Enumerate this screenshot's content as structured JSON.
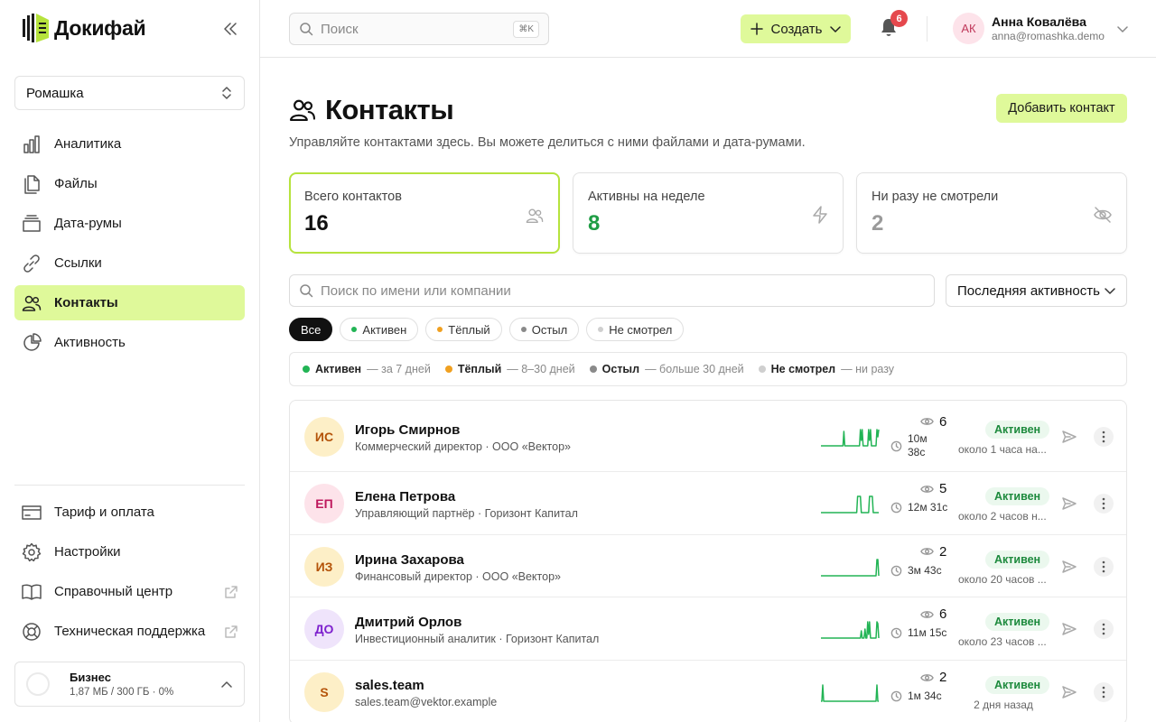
{
  "brand": {
    "name": "Докифай"
  },
  "workspace": {
    "name": "Ромашка"
  },
  "nav": {
    "items": [
      {
        "label": "Аналитика",
        "icon": "bar-chart-icon"
      },
      {
        "label": "Файлы",
        "icon": "files-icon"
      },
      {
        "label": "Дата-румы",
        "icon": "dataroom-icon"
      },
      {
        "label": "Ссылки",
        "icon": "link-icon"
      },
      {
        "label": "Контакты",
        "icon": "contacts-icon",
        "active": true
      },
      {
        "label": "Активность",
        "icon": "pie-chart-icon"
      }
    ],
    "bottom": [
      {
        "label": "Тариф и оплата",
        "icon": "credit-card-icon"
      },
      {
        "label": "Настройки",
        "icon": "gear-icon"
      },
      {
        "label": "Справочный центр",
        "icon": "book-icon",
        "external": true
      },
      {
        "label": "Техническая поддержка",
        "icon": "lifebuoy-icon",
        "external": true
      }
    ]
  },
  "plan": {
    "name": "Бизнес",
    "usage": "1,87 МБ / 300 ГБ · 0%"
  },
  "topbar": {
    "search_placeholder": "Поиск",
    "shortcut": "⌘K",
    "create_label": "Создать",
    "notifications_count": "6",
    "user": {
      "initials": "АК",
      "name": "Анна Ковалёва",
      "email": "anna@romashka.demo"
    }
  },
  "page": {
    "title": "Контакты",
    "subtitle": "Управляйте контактами здесь. Вы можете делиться с ними файлами и дата-румами.",
    "add_label": "Добавить контакт"
  },
  "stats": [
    {
      "label": "Всего контактов",
      "value": "16",
      "color": "#111111",
      "icon": "users-icon"
    },
    {
      "label": "Активны на неделе",
      "value": "8",
      "color": "#1f9d45",
      "icon": "zap-icon"
    },
    {
      "label": "Ни разу не смотрели",
      "value": "2",
      "color": "#9a9a9a",
      "icon": "eye-off-icon"
    }
  ],
  "filters": {
    "search_placeholder": "Поиск по имени или компании",
    "sort_label": "Последняя активность",
    "pills": [
      {
        "label": "Все",
        "active": true
      },
      {
        "label": "Активен",
        "dot": "#22b455"
      },
      {
        "label": "Тёплый",
        "dot": "#f0a020"
      },
      {
        "label": "Остыл",
        "dot": "#8a8a8a"
      },
      {
        "label": "Не смотрел",
        "dot": "#cfcfcf"
      }
    ]
  },
  "legend": [
    {
      "label": "Активен",
      "desc": "— за 7 дней",
      "color": "#22b455"
    },
    {
      "label": "Тёплый",
      "desc": "— 8–30 дней",
      "color": "#f0a020"
    },
    {
      "label": "Остыл",
      "desc": "— больше 30 дней",
      "color": "#8a8a8a"
    },
    {
      "label": "Не смотрел",
      "desc": "— ни разу",
      "color": "#cfcfcf"
    }
  ],
  "contacts": [
    {
      "initials": "ИС",
      "name": "Игорь Смирнов",
      "subtitle": "Коммерческий директор · ООО «Вектор»",
      "views": "6",
      "duration": [
        "10м",
        "38с"
      ],
      "status": "Активен",
      "last_active": "около 1 часа на...",
      "avatar_bg": "#fdefc7",
      "avatar_fg": "#b45309",
      "spark": [
        0,
        0,
        0,
        0,
        0,
        0,
        0,
        0,
        0,
        0,
        0,
        0,
        0,
        0,
        0,
        0,
        0,
        0,
        0,
        0,
        0,
        0,
        0,
        0,
        0,
        0.8,
        0,
        0,
        0,
        0,
        0,
        0,
        0,
        0,
        0,
        0,
        0,
        0,
        0,
        0,
        0,
        0,
        0,
        0.9,
        0.3,
        0.9,
        0,
        0,
        0,
        0,
        0,
        0,
        0.9,
        0.3,
        0.9,
        0,
        0,
        0,
        0,
        0,
        0,
        0.9,
        0.5,
        0.9
      ]
    },
    {
      "initials": "ЕП",
      "name": "Елена Петрова",
      "subtitle": "Управляющий партнёр · Горизонт Капитал",
      "views": "5",
      "duration": [
        "12м 31с"
      ],
      "status": "Активен",
      "last_active": "около 2 часов н...",
      "avatar_bg": "#fde3ea",
      "avatar_fg": "#be185d",
      "spark": [
        0,
        0,
        0,
        0,
        0,
        0,
        0,
        0,
        0,
        0,
        0,
        0,
        0,
        0,
        0,
        0,
        0,
        0,
        0,
        0,
        0,
        0,
        0,
        0,
        0,
        0,
        0,
        0,
        0,
        0,
        0,
        0,
        0,
        0,
        0,
        0,
        0,
        0,
        0,
        0,
        0.9,
        0.9,
        0.9,
        0.9,
        0,
        0,
        0,
        0,
        0,
        0,
        0,
        0,
        0,
        0.9,
        0.9,
        0.9,
        0.9,
        0,
        0,
        0,
        0,
        0,
        0,
        0
      ]
    },
    {
      "initials": "ИЗ",
      "name": "Ирина Захарова",
      "subtitle": "Финансовый директор · ООО «Вектор»",
      "views": "2",
      "duration": [
        "3м 43с"
      ],
      "status": "Активен",
      "last_active": "около 20 часов ...",
      "avatar_bg": "#fdefc7",
      "avatar_fg": "#b45309",
      "spark": [
        0,
        0,
        0,
        0,
        0,
        0,
        0,
        0,
        0,
        0,
        0,
        0,
        0,
        0,
        0,
        0,
        0,
        0,
        0,
        0,
        0,
        0,
        0,
        0,
        0,
        0,
        0,
        0,
        0,
        0,
        0,
        0,
        0,
        0,
        0,
        0,
        0,
        0,
        0,
        0,
        0,
        0,
        0,
        0,
        0,
        0,
        0,
        0,
        0,
        0,
        0,
        0,
        0,
        0,
        0,
        0,
        0,
        0,
        0,
        0,
        0,
        0.9,
        0.9,
        0
      ]
    },
    {
      "initials": "ДО",
      "name": "Дмитрий Орлов",
      "subtitle": "Инвестиционный аналитик · Горизонт Капитал",
      "views": "6",
      "duration": [
        "11м 15с"
      ],
      "status": "Активен",
      "last_active": "около 23 часов ...",
      "avatar_bg": "#efe4fb",
      "avatar_fg": "#7e22ce",
      "spark": [
        0,
        0,
        0,
        0,
        0,
        0,
        0,
        0,
        0,
        0,
        0,
        0,
        0,
        0,
        0,
        0,
        0,
        0,
        0,
        0,
        0,
        0,
        0,
        0,
        0,
        0,
        0,
        0,
        0,
        0,
        0,
        0,
        0,
        0,
        0,
        0,
        0,
        0,
        0,
        0,
        0,
        0,
        0,
        0,
        0.4,
        0,
        0,
        0,
        0.5,
        0,
        0,
        0.9,
        0.2,
        0.9,
        0,
        0,
        0,
        0,
        0,
        0,
        0,
        0.9,
        0.8,
        0
      ]
    },
    {
      "initials": "S",
      "name": "sales.team",
      "subtitle": "sales.team@vektor.example",
      "views": "2",
      "duration": [
        "1м 34с"
      ],
      "status": "Активен",
      "last_active": "2 дня назад",
      "avatar_bg": "#fdefc7",
      "avatar_fg": "#b45309",
      "spark": [
        0,
        0,
        0.9,
        0,
        0,
        0,
        0,
        0,
        0,
        0,
        0,
        0,
        0,
        0,
        0,
        0,
        0,
        0,
        0,
        0,
        0,
        0,
        0,
        0,
        0,
        0,
        0,
        0,
        0,
        0,
        0,
        0,
        0,
        0,
        0,
        0,
        0,
        0,
        0,
        0,
        0,
        0,
        0,
        0,
        0,
        0,
        0,
        0,
        0,
        0,
        0,
        0,
        0,
        0,
        0,
        0,
        0,
        0,
        0,
        0,
        0,
        0.9,
        0,
        0
      ]
    }
  ]
}
